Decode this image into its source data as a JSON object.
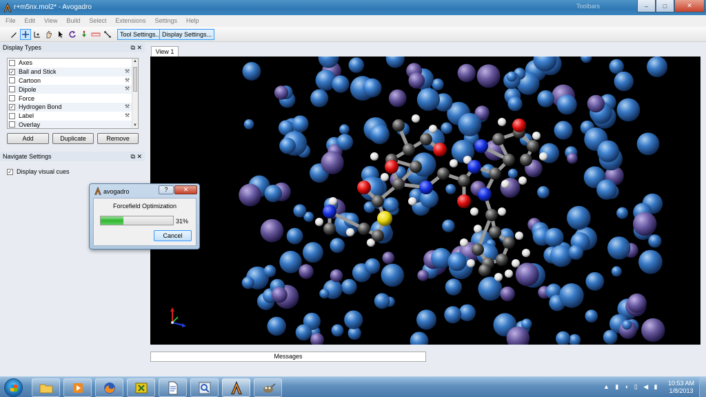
{
  "window": {
    "title": "r+m5nx.mol2* - Avogadro",
    "ghost_text": "Toolbars",
    "controls": {
      "minimize": "–",
      "maximize": "□",
      "close": "✕"
    }
  },
  "menu": [
    "File",
    "Edit",
    "View",
    "Build",
    "Select",
    "Extensions",
    "Settings",
    "Help"
  ],
  "toolbar": {
    "tools": [
      "draw-tool",
      "navigate-tool",
      "bond-centric-tool",
      "manipulate-tool",
      "select-tool",
      "auto-rotate-tool",
      "auto-optimize-tool",
      "measure-tool",
      "align-tool"
    ],
    "tool_settings": "Tool Settings...",
    "display_settings": "Display Settings..."
  },
  "display_types": {
    "header": "Display Types",
    "items": [
      {
        "label": "Axes",
        "checked": false,
        "configurable": false
      },
      {
        "label": "Ball and Stick",
        "checked": true,
        "configurable": true
      },
      {
        "label": "Cartoon",
        "checked": false,
        "configurable": true
      },
      {
        "label": "Dipole",
        "checked": false,
        "configurable": true
      },
      {
        "label": "Force",
        "checked": false,
        "configurable": false
      },
      {
        "label": "Hydrogen Bond",
        "checked": true,
        "configurable": true
      },
      {
        "label": "Label",
        "checked": false,
        "configurable": true
      },
      {
        "label": "Overlay",
        "checked": false,
        "configurable": false
      }
    ],
    "buttons": {
      "add": "Add",
      "duplicate": "Duplicate",
      "remove": "Remove"
    }
  },
  "navigate_settings": {
    "header": "Navigate Settings",
    "visual_cues_label": "Display visual cues",
    "visual_cues_checked": true
  },
  "view": {
    "tab": "View 1",
    "messages": "Messages"
  },
  "dialog": {
    "title": "avogadro",
    "help": "?",
    "close": "✕",
    "label": "Forcefield Optimization",
    "progress_percent": 31,
    "progress_text": "31%",
    "cancel": "Cancel"
  },
  "taskbar": {
    "apps": [
      "file-explorer-icon",
      "media-player-icon",
      "firefox-icon",
      "puzzle-app-icon",
      "document-icon",
      "magnifier-app-icon",
      "avogadro-icon",
      "gimp-icon"
    ],
    "time": "10:53 AM",
    "date": "1/8/2013"
  },
  "colors": {
    "carbon": "#555555",
    "oxygen": "#e01010",
    "nitrogen": "#1530e0",
    "hydrogen": "#eeeeee",
    "sulfur": "#e8d80a",
    "water_blue": "#3a7fcf",
    "water_purple": "#7a6aa8"
  }
}
